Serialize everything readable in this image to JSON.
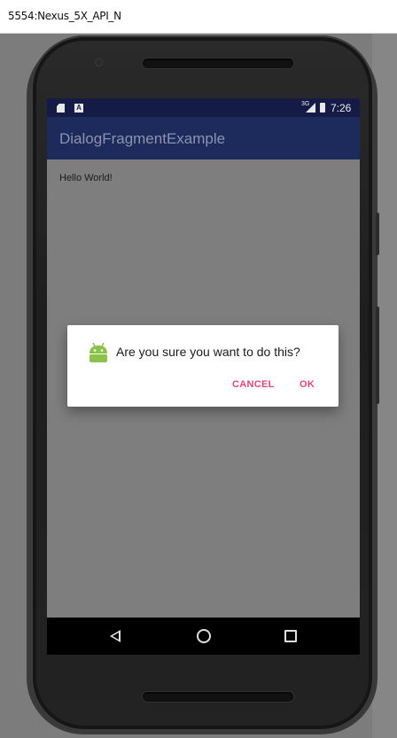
{
  "window": {
    "title": "5554:Nexus_5X_API_N"
  },
  "statusbar": {
    "time": "7:26",
    "network": "3G",
    "icons": [
      "sd-card-icon",
      "a-notification-icon",
      "signal-icon",
      "battery-icon"
    ]
  },
  "app": {
    "title": "DialogFragmentExample",
    "body_text": "Hello World!"
  },
  "dialog": {
    "icon": "android-icon",
    "message": "Are you sure you want to do this?",
    "cancel_label": "CANCEL",
    "ok_label": "OK"
  },
  "navbar": {
    "buttons": [
      "back-icon",
      "home-icon",
      "recents-icon"
    ]
  },
  "colors": {
    "statusbar": "#131b46",
    "appbar": "#1d2a5c",
    "accent": "#e0457a",
    "scrim_screen": "#7e7e7e"
  }
}
